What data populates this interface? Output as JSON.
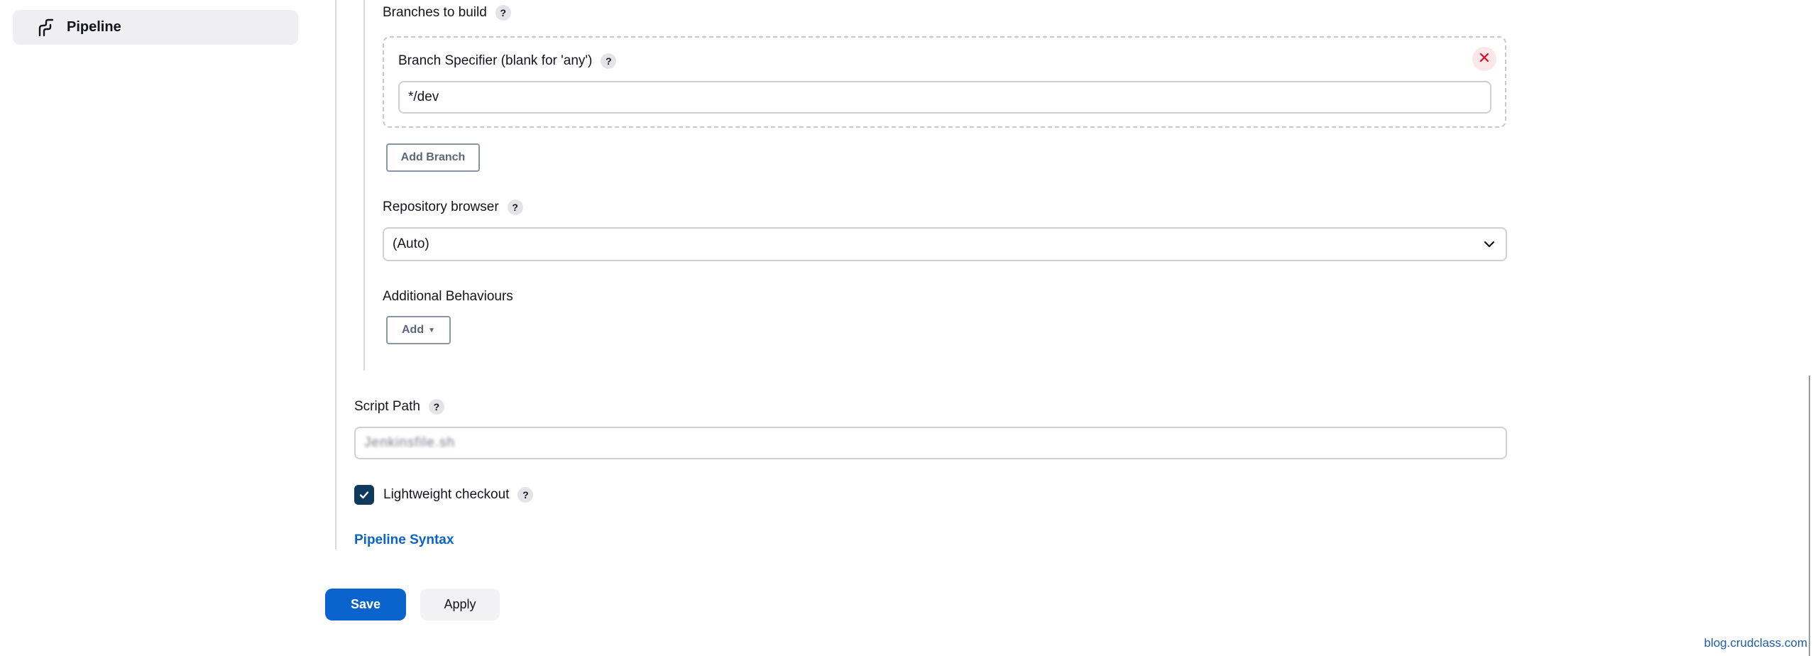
{
  "sidebar": {
    "items": [
      {
        "label": "Pipeline",
        "icon": "pipeline-icon"
      }
    ]
  },
  "branches": {
    "section_label": "Branches to build",
    "specifier_label": "Branch Specifier (blank for 'any')",
    "specifier_value": "*/dev",
    "add_branch_label": "Add Branch"
  },
  "repository_browser": {
    "label": "Repository browser",
    "selected": "(Auto)"
  },
  "additional_behaviours": {
    "label": "Additional Behaviours",
    "add_label": "Add"
  },
  "script_path": {
    "label": "Script Path",
    "value": "Jenkinsfile.sh"
  },
  "lightweight_checkout": {
    "label": "Lightweight checkout",
    "checked": true
  },
  "pipeline_syntax_link": "Pipeline Syntax",
  "help_glyph": "?",
  "footer": {
    "save_label": "Save",
    "apply_label": "Apply"
  },
  "watermark": "blog.crudclass.com",
  "colors": {
    "primary": "#0b63ce",
    "link": "#0b63c7",
    "checkbox": "#0e3a5e",
    "danger": "#e6001f"
  }
}
